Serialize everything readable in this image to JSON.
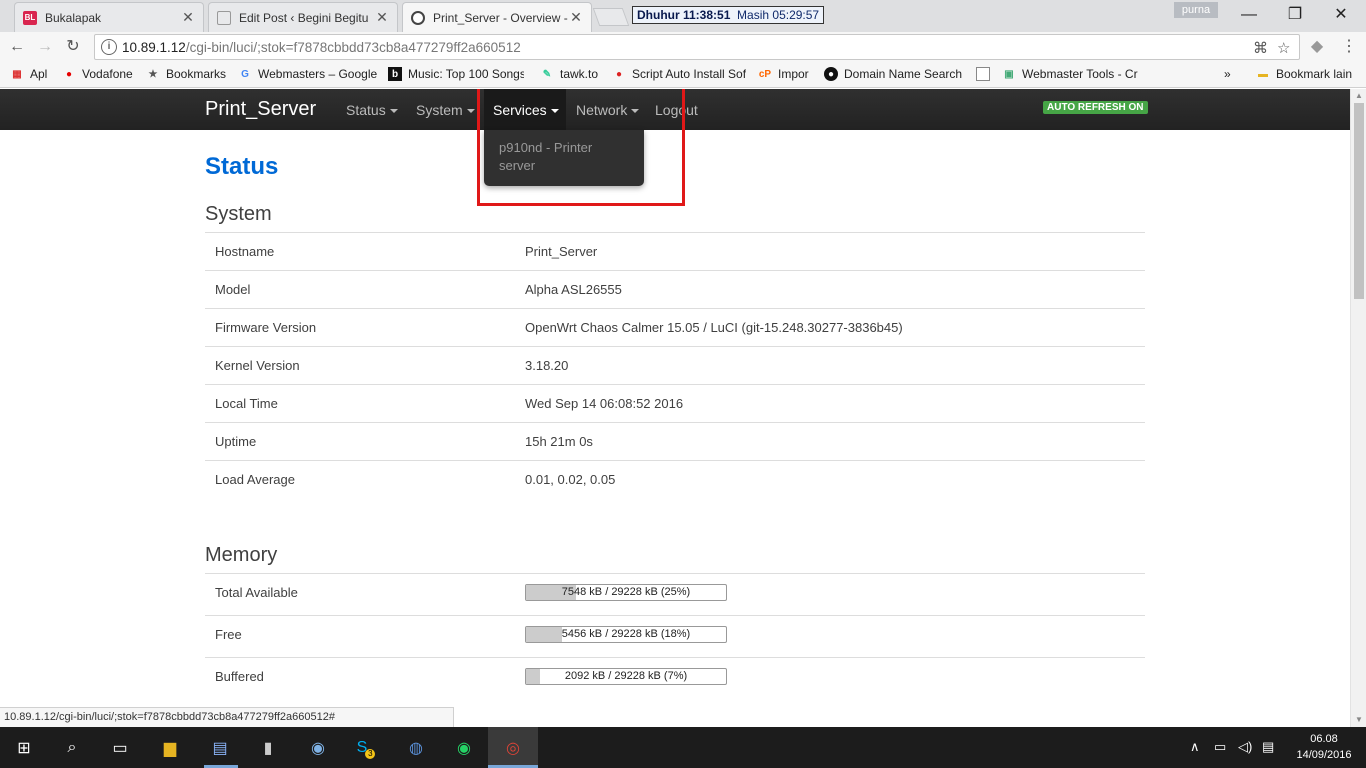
{
  "browser": {
    "tabs": [
      {
        "title": "Bukalapak",
        "favicon": "BL"
      },
      {
        "title": "Edit Post ‹ Begini Begitu",
        "favicon": ""
      },
      {
        "title": "Print_Server - Overview -",
        "favicon": ""
      }
    ],
    "prayer_widget": {
      "prayer": "Dhuhur 11:38:51",
      "remaining": "Masih 05:29:57"
    },
    "profile_name": "purna",
    "address": {
      "host": "10.89.1.12",
      "path": "/cgi-bin/luci/;stok=f7878cbbdd73cb8a477279ff2a660512"
    },
    "bookmarks": [
      "Apl",
      "Vodafone",
      "Bookmarks",
      "Webmasters – Google",
      "Music: Top 100 Songs",
      "tawk.to",
      "Script Auto Install Sof",
      "Impor",
      "Domain Name Search",
      "",
      "Webmaster Tools - Cr"
    ],
    "bookmarks_more": "»",
    "other_bookmarks": "Bookmark lain",
    "status_url": "10.89.1.12/cgi-bin/luci/;stok=f7878cbbdd73cb8a477279ff2a660512#"
  },
  "luci": {
    "brand": "Print_Server",
    "menu": {
      "status": "Status",
      "system": "System",
      "services": "Services",
      "network": "Network",
      "logout": "Logout"
    },
    "services_dropdown": [
      "p910nd - Printer server"
    ],
    "auto_refresh": "AUTO REFRESH ON",
    "page_title": "Status",
    "system_heading": "System",
    "system_rows": [
      {
        "k": "Hostname",
        "v": "Print_Server"
      },
      {
        "k": "Model",
        "v": "Alpha ASL26555"
      },
      {
        "k": "Firmware Version",
        "v": "OpenWrt Chaos Calmer 15.05 / LuCI (git-15.248.30277-3836b45)"
      },
      {
        "k": "Kernel Version",
        "v": "3.18.20"
      },
      {
        "k": "Local Time",
        "v": "Wed Sep 14 06:08:52 2016"
      },
      {
        "k": "Uptime",
        "v": "15h 21m 0s"
      },
      {
        "k": "Load Average",
        "v": "0.01, 0.02, 0.05"
      }
    ],
    "memory_heading": "Memory",
    "memory_rows": [
      {
        "k": "Total Available",
        "v": "7548 kB / 29228 kB (25%)",
        "fraction": 0.25
      },
      {
        "k": "Free",
        "v": "5456 kB / 29228 kB (18%)",
        "fraction": 0.18
      },
      {
        "k": "Buffered",
        "v": "2092 kB / 29228 kB (7%)",
        "fraction": 0.07
      }
    ]
  },
  "taskbar": {
    "clock_time": "06.08",
    "clock_date": "14/09/2016",
    "skype_badge": "3"
  },
  "colors": {
    "accent": "#0069d6",
    "navbar": "#222222",
    "highlight": "#e01818",
    "autorefresh": "#46a546"
  }
}
